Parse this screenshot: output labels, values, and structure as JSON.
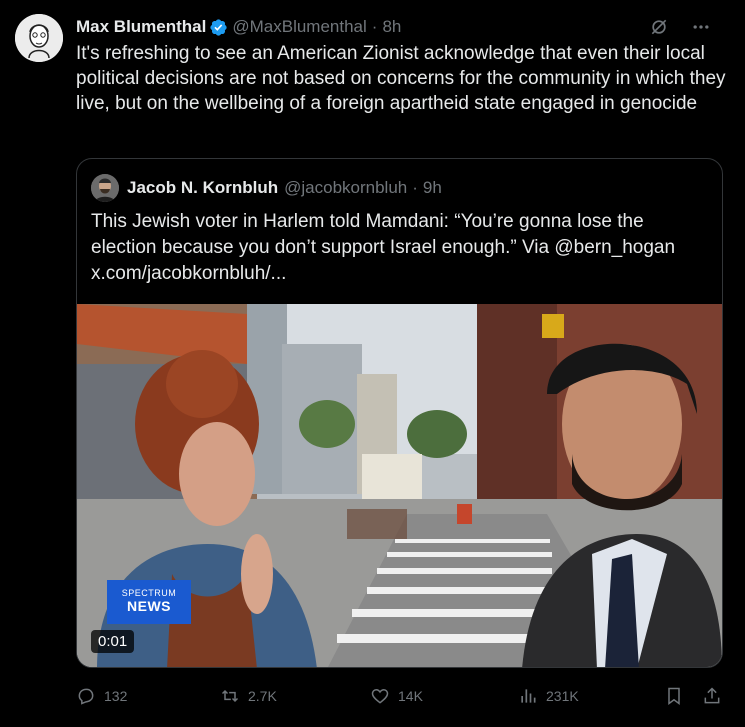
{
  "author": {
    "name": "Max Blumenthal",
    "handle": "@MaxBlumenthal",
    "time": "8h",
    "verified": true
  },
  "separator": "·",
  "tweet_text": "It's refreshing to see an American Zionist acknowledge that even their local political decisions are not based on concerns for the community in which they live, but on the wellbeing of a foreign apartheid state engaged in genocide",
  "quoted": {
    "name": "Jacob N. Kornbluh",
    "handle": "@jacobkornbluh",
    "time": "9h",
    "text_line1": "This Jewish voter in Harlem told Mamdani: “You’re gonna lose the",
    "text_line2": "election because you don’t support Israel enough.” Via @bern_hogan",
    "link": "x.com/jacobkornbluh/...",
    "video": {
      "timestamp": "0:01",
      "badge_line1": "SPECTRUM",
      "badge_line2": "NEWS"
    }
  },
  "actions": {
    "replies": "132",
    "reposts": "2.7K",
    "likes": "14K",
    "views": "231K"
  },
  "colors": {
    "background": "#000000",
    "text": "#e7e9ea",
    "muted": "#71767b",
    "border": "#333639",
    "verified": "#1d9bf0"
  },
  "icons": [
    "verified-badge-icon",
    "grok-icon",
    "more-icon",
    "reply-icon",
    "repost-icon",
    "like-icon",
    "views-icon",
    "bookmark-icon",
    "share-icon"
  ]
}
